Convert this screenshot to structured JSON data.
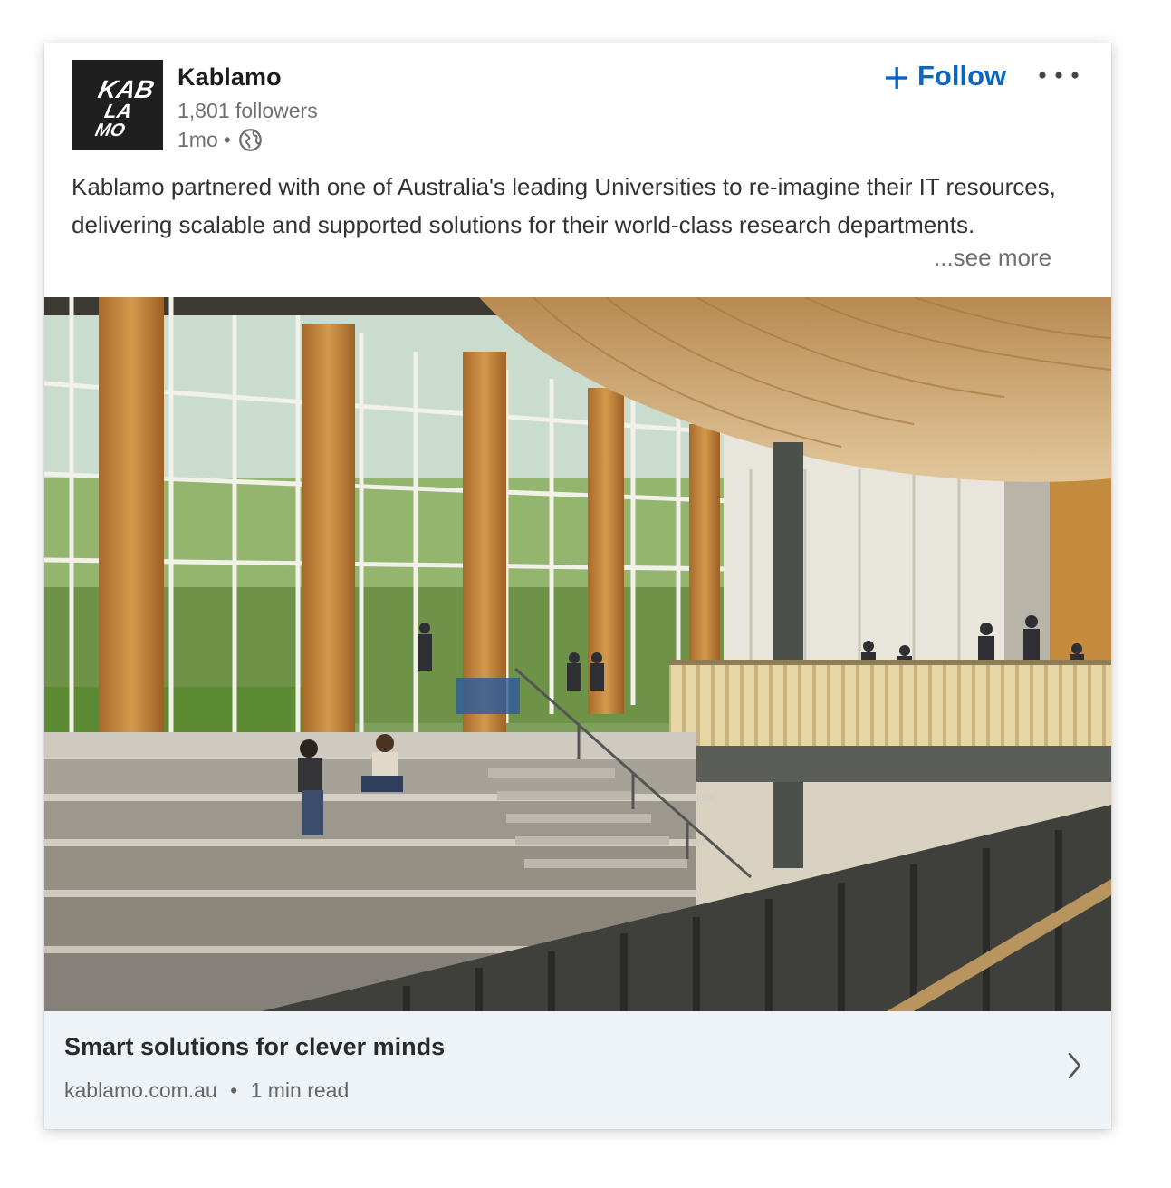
{
  "post": {
    "company": {
      "name": "Kablamo",
      "followers": "1,801 followers",
      "time": "1mo",
      "separator": "•",
      "logo_text": [
        "KAB",
        "LA",
        "MO"
      ],
      "visibility_icon": "globe-icon"
    },
    "actions": {
      "follow_label": "Follow",
      "follow_icon": "plus-icon",
      "more_icon": "more-options-icon"
    },
    "text": "Kablamo partnered with one of Australia's leading Universities to re-imagine their IT resources, delivering scalable and supported solutions for their world-class research departments.",
    "see_more": "...see more",
    "image_icon": "university-atrium-photo",
    "link": {
      "title": "Smart solutions for clever minds",
      "domain": "kablamo.com.au",
      "separator": "•",
      "read_time": "1 min read",
      "arrow_icon": "chevron-right-icon"
    }
  },
  "colors": {
    "accent": "#0a66c2",
    "footer_bg": "#eef3f8",
    "logo_bg": "#1f1f1f"
  }
}
